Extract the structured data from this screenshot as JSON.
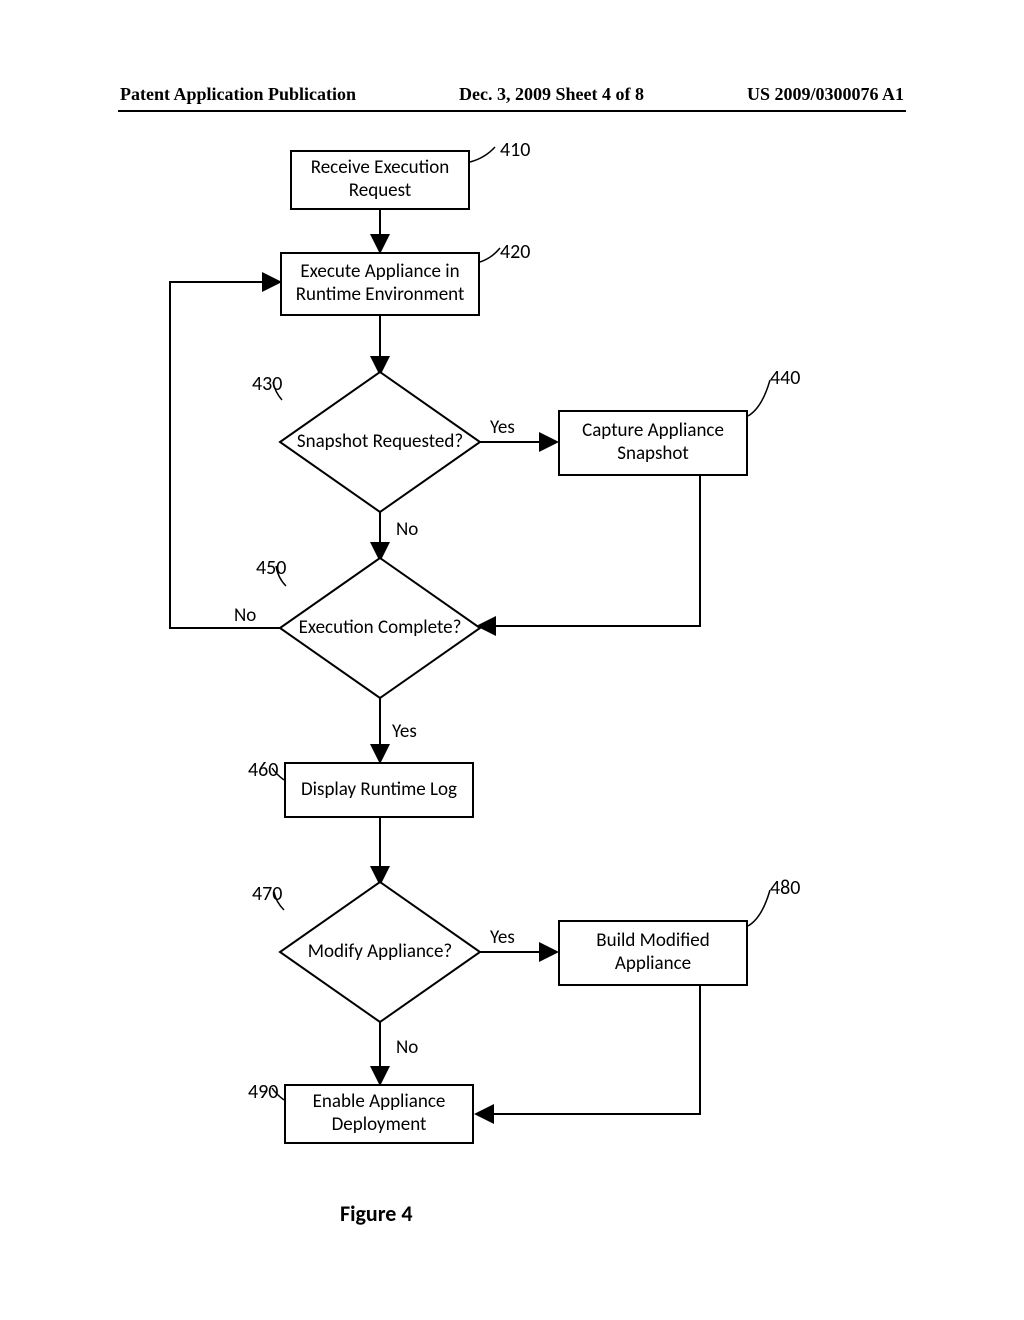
{
  "header": {
    "left": "Patent Application Publication",
    "center": "Dec. 3, 2009  Sheet 4 of 8",
    "right": "US 2009/0300076 A1"
  },
  "refs": {
    "r410": "410",
    "r420": "420",
    "r430": "430",
    "r440": "440",
    "r450": "450",
    "r460": "460",
    "r470": "470",
    "r480": "480",
    "r490": "490"
  },
  "nodes": {
    "b410": "Receive Execution Request",
    "b420": "Execute Appliance in Runtime Environment",
    "d430": "Snapshot Requested?",
    "b440": "Capture Appliance Snapshot",
    "d450": "Execution Complete?",
    "b460": "Display Runtime Log",
    "d470": "Modify Appliance?",
    "b480": "Build Modified Appliance",
    "b490": "Enable Appliance Deployment"
  },
  "labels": {
    "yes": "Yes",
    "no": "No"
  },
  "caption": "Figure 4"
}
